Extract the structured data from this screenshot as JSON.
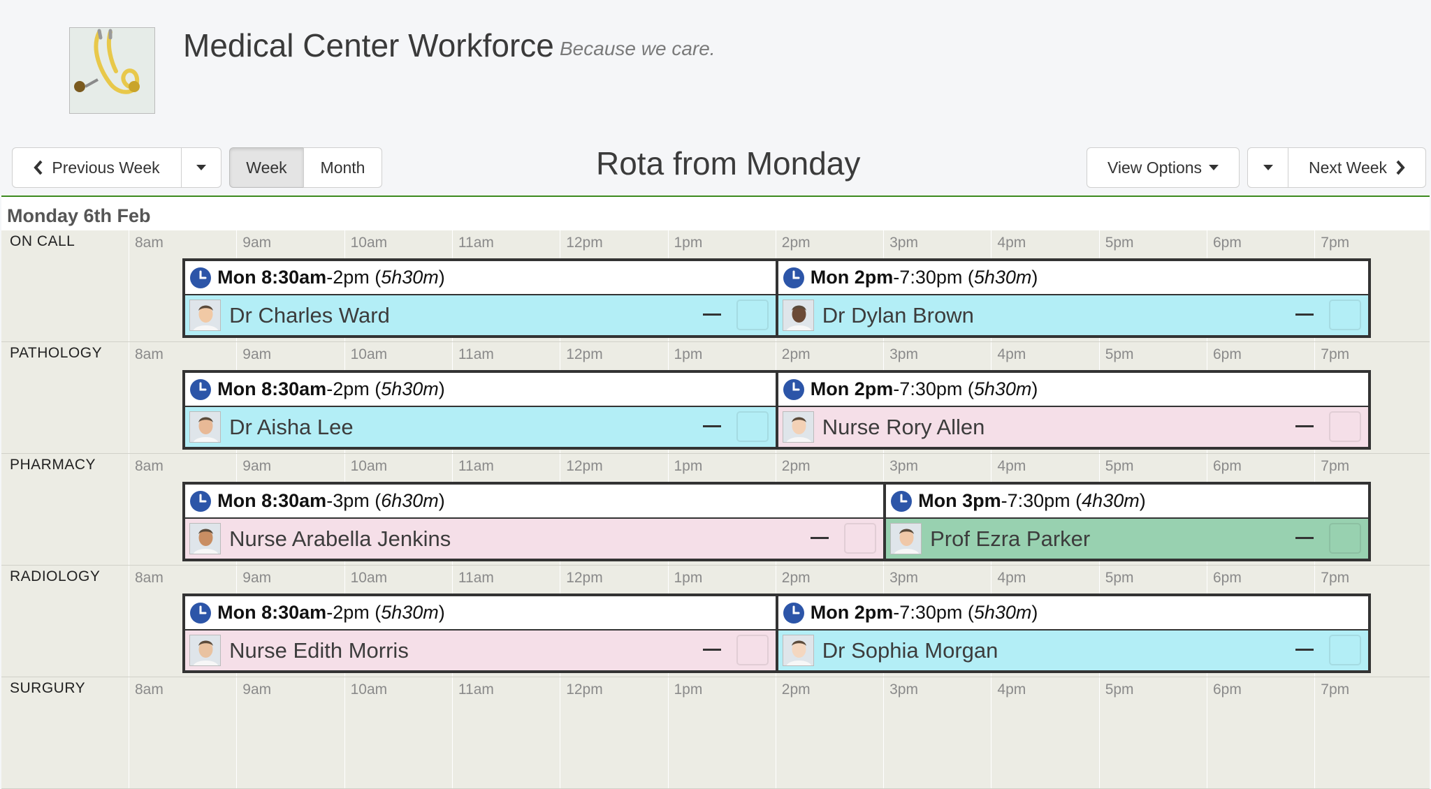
{
  "app": {
    "title": "Medical Center Workforce",
    "tagline": "Because we care."
  },
  "toolbar": {
    "prev_week": "Previous Week",
    "week": "Week",
    "month": "Month",
    "rota_title": "Rota from Monday",
    "view_options": "View Options",
    "next_week": "Next Week"
  },
  "colors": {
    "accent_rule": "#3c8a1e",
    "doctor": "#b3eef6",
    "nurse": "#f5dfe8",
    "professor": "#98d1b0",
    "clock": "#2c55a8"
  },
  "day": {
    "label": "Monday 6th Feb"
  },
  "hours": [
    "8am",
    "9am",
    "10am",
    "11am",
    "12pm",
    "1pm",
    "2pm",
    "3pm",
    "4pm",
    "5pm",
    "6pm",
    "7pm"
  ],
  "rows": [
    {
      "dept": "ON CALL",
      "shifts": [
        {
          "start": "Mon 8:30am",
          "end": "2pm",
          "duration": "5h30m",
          "staff": "Dr Charles Ward",
          "role": "doctor"
        },
        {
          "start": "Mon 2pm",
          "end": "7:30pm",
          "duration": "5h30m",
          "staff": "Dr Dylan Brown",
          "role": "doctor"
        }
      ]
    },
    {
      "dept": "PATHOLOGY",
      "shifts": [
        {
          "start": "Mon 8:30am",
          "end": "2pm",
          "duration": "5h30m",
          "staff": "Dr Aisha Lee",
          "role": "doctor"
        },
        {
          "start": "Mon 2pm",
          "end": "7:30pm",
          "duration": "5h30m",
          "staff": "Nurse Rory Allen",
          "role": "nurse"
        }
      ]
    },
    {
      "dept": "PHARMACY",
      "shifts": [
        {
          "start": "Mon 8:30am",
          "end": "3pm",
          "duration": "6h30m",
          "staff": "Nurse Arabella Jenkins",
          "role": "nurse"
        },
        {
          "start": "Mon 3pm",
          "end": "7:30pm",
          "duration": "4h30m",
          "staff": "Prof Ezra Parker",
          "role": "professor"
        }
      ]
    },
    {
      "dept": "RADIOLOGY",
      "shifts": [
        {
          "start": "Mon 8:30am",
          "end": "2pm",
          "duration": "5h30m",
          "staff": "Nurse Edith Morris",
          "role": "nurse"
        },
        {
          "start": "Mon 2pm",
          "end": "7:30pm",
          "duration": "5h30m",
          "staff": "Dr Sophia Morgan",
          "role": "doctor"
        }
      ]
    },
    {
      "dept": "SURGURY",
      "shifts": []
    }
  ]
}
